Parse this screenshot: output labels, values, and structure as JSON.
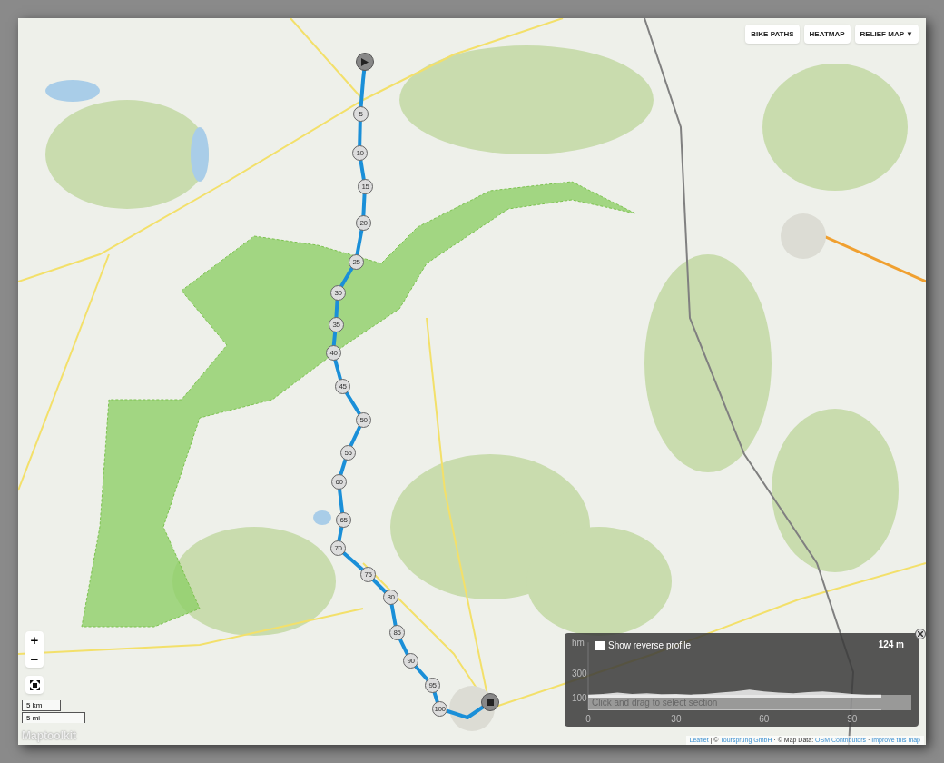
{
  "layer_buttons": [
    {
      "label": "BIKE PATHS"
    },
    {
      "label": "HEATMAP"
    },
    {
      "label": "RELIEF MAP ▼"
    }
  ],
  "zoom": {
    "in": "+",
    "out": "−"
  },
  "scale": {
    "metric": "5 km",
    "imperial": "5 mi"
  },
  "logo": "Maptoolkit",
  "route_markers": [
    "5",
    "10",
    "15",
    "20",
    "25",
    "30",
    "35",
    "40",
    "45",
    "50",
    "55",
    "60",
    "65",
    "70",
    "75",
    "80",
    "85",
    "90",
    "95",
    "100"
  ],
  "profile": {
    "reverse_label": "Show reverse profile",
    "reverse_checked": false,
    "elevation": "124 m",
    "hint": "Click and drag to select section",
    "chart_data": {
      "type": "area",
      "ylabel": "hm",
      "x": [
        0,
        5,
        10,
        15,
        20,
        25,
        30,
        35,
        40,
        45,
        50,
        55,
        60,
        65,
        70,
        75,
        80,
        85,
        90,
        95,
        100
      ],
      "series": [
        {
          "color": "#e8e8e8",
          "values": [
            125,
            130,
            140,
            130,
            135,
            128,
            130,
            125,
            130,
            140,
            150,
            165,
            150,
            140,
            135,
            145,
            150,
            140,
            130,
            125,
            124
          ]
        }
      ],
      "xticks": [
        0,
        30,
        60,
        90
      ],
      "yticks": [
        300,
        100
      ],
      "xlim": [
        0,
        100
      ],
      "ylim": [
        0,
        550
      ]
    }
  },
  "attribution": [
    {
      "kind": "link",
      "text": "Leaflet"
    },
    {
      "kind": "text",
      "text": " | © "
    },
    {
      "kind": "link",
      "text": "Toursprung GmbH"
    },
    {
      "kind": "text",
      "text": " · © Map Data: "
    },
    {
      "kind": "link",
      "text": "OSM Contributors"
    },
    {
      "kind": "text",
      "text": " · "
    },
    {
      "kind": "link",
      "text": "Improve this map"
    }
  ]
}
